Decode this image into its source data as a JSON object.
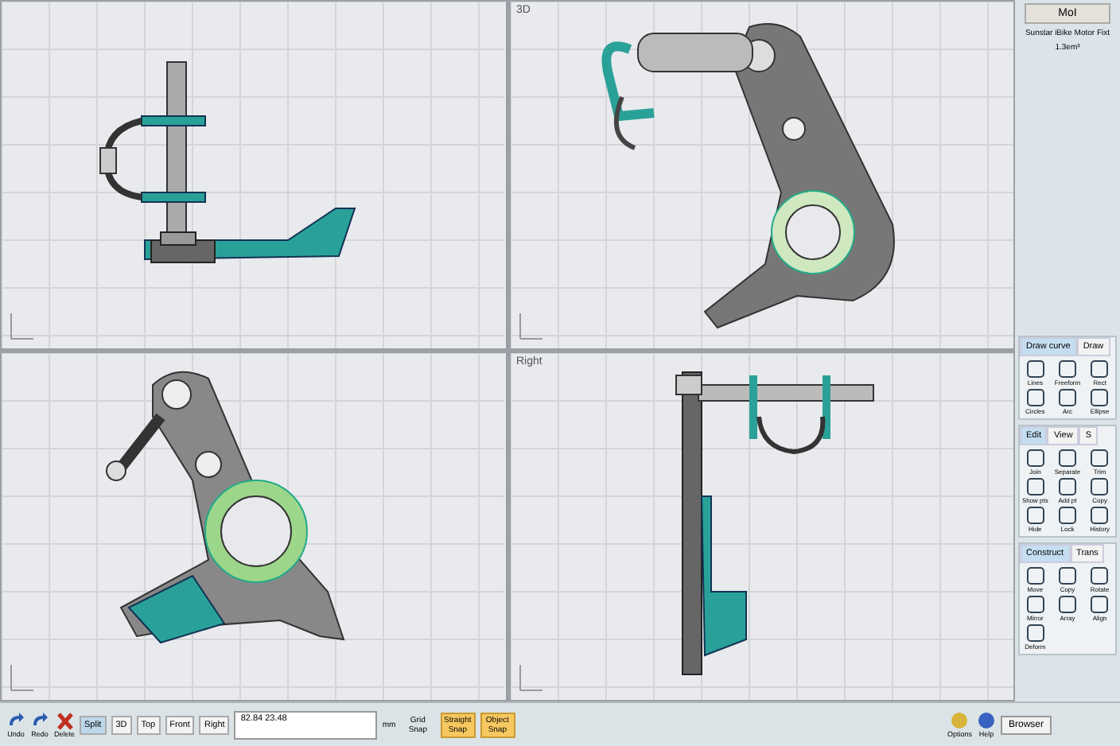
{
  "viewport_titles": {
    "top_right": "3D",
    "bottom_right": "Right"
  },
  "panel": {
    "app_button": "MoI",
    "file_name": "Sunstar iBike Motor Fixt",
    "file_info": "1.3em³",
    "groups": [
      {
        "tabs": [
          {
            "label": "Draw curve",
            "selected": true
          },
          {
            "label": "Draw",
            "selected": false
          }
        ],
        "tools": [
          "Lines",
          "Freeform",
          "Rect",
          "Circles",
          "Arc",
          "Ellipse"
        ]
      },
      {
        "tabs": [
          {
            "label": "Edit",
            "selected": true
          },
          {
            "label": "View",
            "selected": false
          },
          {
            "label": "S",
            "selected": false
          }
        ],
        "tools": [
          "Join",
          "Separate",
          "Trim",
          "Show pts",
          "Add pt",
          "Copy",
          "Hide",
          "Lock",
          "History"
        ]
      },
      {
        "tabs": [
          {
            "label": "Construct",
            "selected": true
          },
          {
            "label": "Trans",
            "selected": false
          }
        ],
        "tools": [
          "Move",
          "Copy",
          "Rotate",
          "Mirror",
          "Array",
          "Align",
          "Deform"
        ]
      }
    ]
  },
  "bottom_bar": {
    "edit_buttons": [
      "Undo",
      "Redo",
      "Delete"
    ],
    "view_buttons": [
      {
        "label": "Split",
        "selected": true
      },
      {
        "label": "3D",
        "selected": false
      },
      {
        "label": "Top",
        "selected": false
      },
      {
        "label": "Front",
        "selected": false
      },
      {
        "label": "Right",
        "selected": false
      }
    ],
    "coordinates": "82.84  23.48",
    "unit": "mm",
    "snaps": [
      {
        "label": "Grid Snap",
        "on": false
      },
      {
        "label": "Straight Snap",
        "on": true
      },
      {
        "label": "Object Snap",
        "on": true
      }
    ],
    "right_buttons": [
      "Options",
      "Help"
    ],
    "browser_button": "Browser"
  }
}
